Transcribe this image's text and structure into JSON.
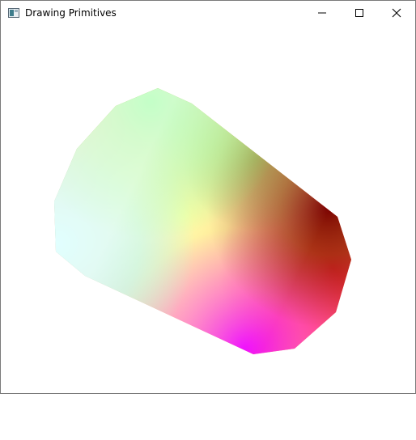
{
  "window": {
    "title": "Drawing Primitives",
    "icon": "app-window-icon",
    "controls": {
      "minimize_icon": "minimize-icon",
      "maximize_icon": "maximize-icon",
      "close_icon": "close-icon"
    }
  },
  "scene": {
    "shape": "gradient-shaded-cylinder",
    "colors": {
      "green": "#22ff22",
      "cyan": "#7fffff",
      "yellow": "#ffff44",
      "magenta": "#ff00ff",
      "red": "#ff0044",
      "dark_red": "#7a0000",
      "olive": "#6b7a00"
    }
  }
}
